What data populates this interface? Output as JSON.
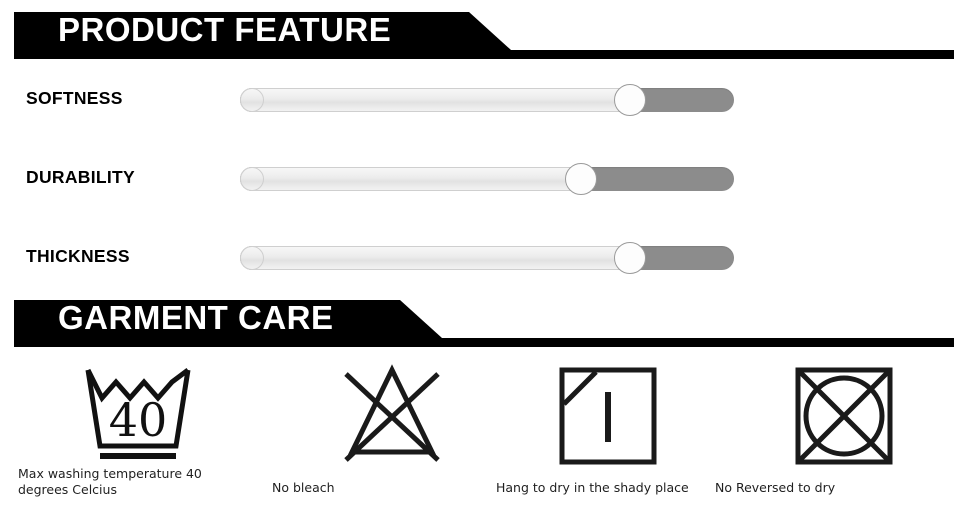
{
  "sections": {
    "product_feature": {
      "title": "PRODUCT FEATURE",
      "features": [
        {
          "label": "SOFTNESS",
          "value": 79,
          "icon": "slider-knob-icon"
        },
        {
          "label": "DURABILITY",
          "value": 69,
          "icon": "slider-knob-icon"
        },
        {
          "label": "THICKNESS",
          "value": 79,
          "icon": "slider-knob-icon"
        }
      ]
    },
    "garment_care": {
      "title": "GARMENT CARE",
      "symbols": [
        {
          "icon": "wash-tub-40-icon",
          "temperature": "40",
          "caption": "Max washing temperature 40 degrees Celcius"
        },
        {
          "icon": "no-bleach-triangle-icon",
          "caption": "No bleach"
        },
        {
          "icon": "drip-dry-shade-icon",
          "caption": "Hang to dry in the shady place"
        },
        {
          "icon": "no-tumble-dry-icon",
          "caption": "No Reversed to dry"
        }
      ]
    }
  },
  "colors": {
    "banner_background": "#000000",
    "banner_text": "#ffffff",
    "slider_track": "#8c8c8c",
    "slider_fill": "#ececec",
    "slider_knob": "#fdfdfd",
    "label_text": "#000000",
    "caption_text": "#1f1f1f",
    "page_background": "#ffffff"
  }
}
